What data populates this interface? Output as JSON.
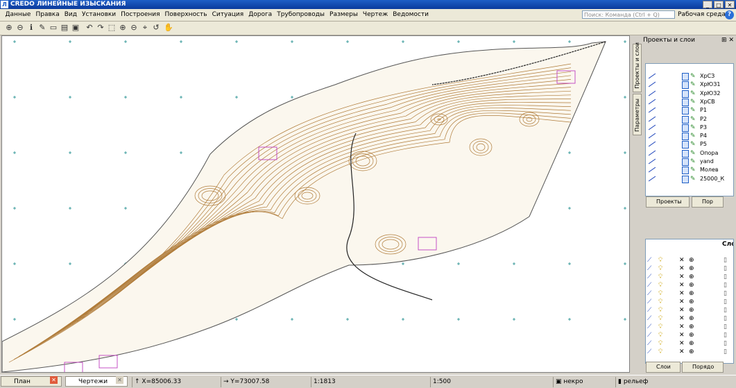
{
  "window": {
    "logo": "Л",
    "title": "CREDO ЛИНЕЙНЫЕ ИЗЫСКАНИЯ",
    "buttons": [
      "_",
      "□",
      "✕"
    ]
  },
  "menu": [
    "Данные",
    "Правка",
    "Вид",
    "Установки",
    "Построения",
    "Поверхность",
    "Ситуация",
    "Дорога",
    "Трубопроводы",
    "Размеры",
    "Чертеж",
    "Ведомости"
  ],
  "command_search": {
    "placeholder": "Поиск: Команда (Ctrl + Q)"
  },
  "workspace_label": "Рабочая среда",
  "panel": {
    "title": "Проекты и слои",
    "vertical_tabs": [
      "Проекты и слои",
      "Параметры"
    ],
    "tree_items": [
      "ХрСЗ",
      "ХрЮЗ1",
      "ХрЮЗ2",
      "ХрСВ",
      "Р1",
      "Р2",
      "Р3",
      "Р4",
      "Р5",
      "Опора",
      "yand",
      "Молев",
      "25000_К"
    ],
    "tabs_top": [
      "Проекты",
      "Пор"
    ],
    "layers_header": "Сло",
    "tabs_bottom": [
      "Слои",
      "Порядо"
    ]
  },
  "status": {
    "tab_plan": "План",
    "tab_drawings": "Чертежи",
    "x_coord": "X=85006.33",
    "y_coord": "Y=73007.58",
    "scale1": "1:1813",
    "scale2": "1:500",
    "layer_necro": "некро",
    "layer_relief": "рельеф"
  },
  "colors": {
    "contour": "#b07c3a",
    "road": "#555555",
    "grid": "#1a8a8a",
    "highlight": "#c040c0"
  }
}
